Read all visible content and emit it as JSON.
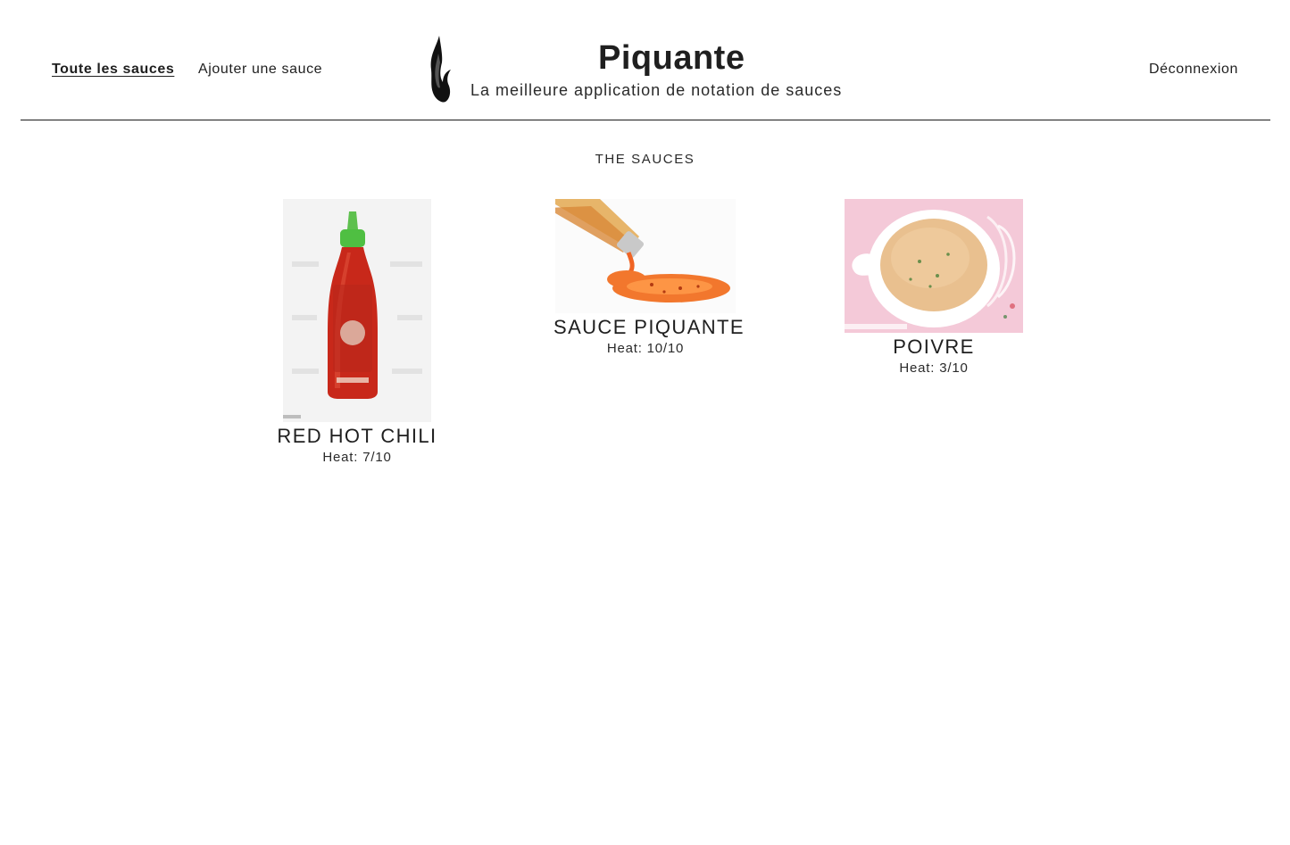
{
  "nav": {
    "all_sauces": "Toute les sauces",
    "add_sauce": "Ajouter une sauce",
    "logout": "Déconnexion"
  },
  "brand": {
    "title": "Piquante",
    "subtitle": "La meilleure application de notation de sauces",
    "logo_icon": "flame-icon"
  },
  "section": {
    "title": "THE SAUCES"
  },
  "sauces": [
    {
      "name": "RED HOT CHILI",
      "heat": "Heat: 7/10",
      "image": "sriracha-bottle-image"
    },
    {
      "name": "SAUCE PIQUANTE",
      "heat": "Heat: 10/10",
      "image": "spilled-sauce-image"
    },
    {
      "name": "POIVRE",
      "heat": "Heat: 3/10",
      "image": "pepper-sauce-bowl-image"
    }
  ],
  "colors": {
    "text": "#1f1f1f",
    "divider": "#1a1a1a",
    "background": "#ffffff"
  }
}
